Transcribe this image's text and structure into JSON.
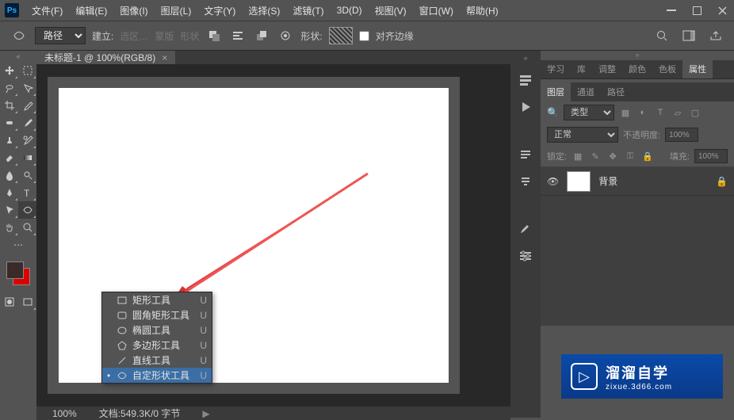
{
  "menu": {
    "items": [
      "文件(F)",
      "编辑(E)",
      "图像(I)",
      "图层(L)",
      "文字(Y)",
      "选择(S)",
      "滤镜(T)",
      "3D(D)",
      "视图(V)",
      "窗口(W)",
      "帮助(H)"
    ]
  },
  "optbar": {
    "mode": "路径",
    "make": "建立:",
    "sel": "选区…",
    "mask": "蒙版",
    "shape": "形状",
    "shapeLbl": "形状:",
    "align": "对齐边缘"
  },
  "doc": {
    "tab": "未标题-1 @ 100%(RGB/8)",
    "zoom": "100%",
    "status": "文档:549.3K/0 字节"
  },
  "flyout": {
    "items": [
      {
        "label": "矩形工具",
        "key": "U"
      },
      {
        "label": "圆角矩形工具",
        "key": "U"
      },
      {
        "label": "椭圆工具",
        "key": "U"
      },
      {
        "label": "多边形工具",
        "key": "U"
      },
      {
        "label": "直线工具",
        "key": "U"
      },
      {
        "label": "自定形状工具",
        "key": "U"
      }
    ]
  },
  "panels": {
    "top": [
      "学习",
      "库",
      "调整",
      "颜色",
      "色板",
      "属性"
    ],
    "layers": [
      "图层",
      "通道",
      "路径"
    ],
    "search": "类型",
    "blend": "正常",
    "opacityLbl": "不透明度:",
    "opacity": "100%",
    "lockLbl": "锁定:",
    "fillLbl": "填充:",
    "fill": "100%",
    "bg": "背景"
  },
  "watermark": {
    "main": "溜溜自学",
    "sub": "zixue.3d66.com"
  }
}
